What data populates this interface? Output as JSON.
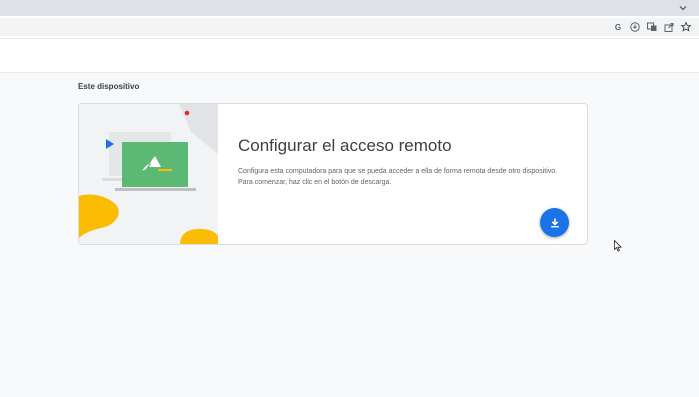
{
  "browser": {
    "toolbar_icons": [
      "google-icon",
      "download-status-icon",
      "translate-icon",
      "share-icon",
      "bookmark-star-icon"
    ],
    "google_glyph": "G"
  },
  "main": {
    "section_title": "Este dispositivo",
    "card": {
      "title": "Configurar el acceso remoto",
      "description_line1": "Configura esta computadora para que se pueda acceder a ella de forma remota desde otro dispositivo.",
      "description_line2": "Para comenzar, haz clic en el botón de descarga.",
      "download_icon": "download-icon"
    }
  },
  "colors": {
    "accent": "#1a73e8",
    "illustration_green": "#5bb974",
    "illustration_yellow": "#fbbc04",
    "illustration_red": "#d93025",
    "illustration_blue": "#1a73e8"
  }
}
